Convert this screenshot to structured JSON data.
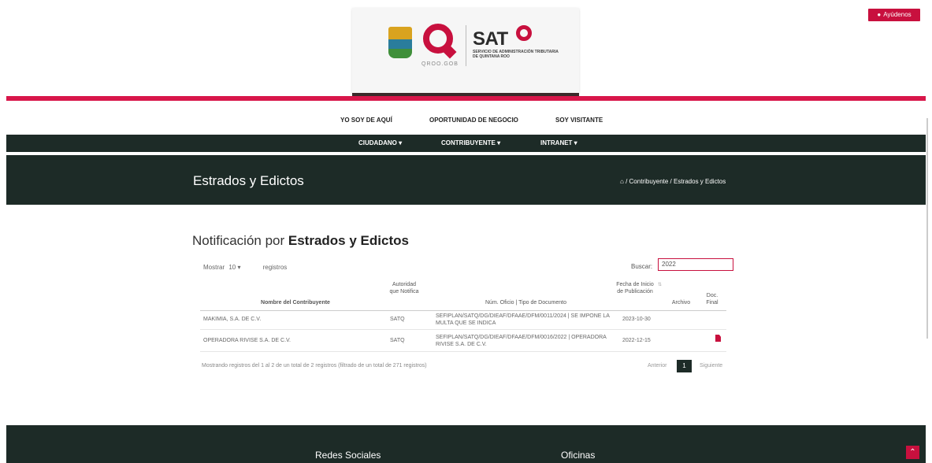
{
  "header": {
    "logo_sub": "QROO.GOB",
    "sat_brand": "SAT",
    "sat_subtitle": "SERVICIO DE ADMINISTRACIÓN TRIBUTARIA DE QUINTANA ROO",
    "ayuda_label": "Ayúdenos"
  },
  "subnav": [
    "YO SOY DE AQUÍ",
    "OPORTUNIDAD DE NEGOCIO",
    "SOY VISITANTE"
  ],
  "mainnav": [
    "CIUDADANO ▾",
    "CONTRIBUYENTE ▾",
    "INTRANET ▾"
  ],
  "banner": {
    "title": "Estrados y Edictos",
    "breadcrumb_home": "⌂",
    "breadcrumb": "/ Contribuyente / Estrados y Edictos"
  },
  "content": {
    "heading_prefix": "Notificación por ",
    "heading_bold": "Estrados y Edictos",
    "mostrar_label": "Mostrar",
    "mostrar_value": "10",
    "mostrar_suffix": "registros",
    "buscar_label": "Buscar:",
    "buscar_value": "2022",
    "table": {
      "headers": [
        "Nombre del Contribuyente",
        "Autoridad que Notifica",
        "Núm. Oficio | Tipo de Documento",
        "Fecha de Inicio de Publicación",
        "Archivo",
        "Doc. Final"
      ],
      "rows": [
        {
          "nombre": "MAKIMIA, S.A. DE C.V.",
          "autoridad": "SATQ",
          "oficio": "SEFIPLAN/SATQ/DG/DIEAF/DFAAE/DFM/0011/2024 | SE IMPONE LA MULTA QUE SE INDICA",
          "fecha": "2023-10-30"
        },
        {
          "nombre": "OPERADORA RIVISE S.A. DE C.V.",
          "autoridad": "SATQ",
          "oficio": "SEFIPLAN/SATQ/DG/DIEAF/DFAAE/DFM/0016/2022 | OPERADORA RIVISE S.A. DE C.V.",
          "fecha": "2022-12-15"
        }
      ]
    },
    "info": "Mostrando registros del 1 al 2 de un total de 2 registros (filtrado de un total de 271 registros)",
    "pag_prev": "Anterior",
    "pag_current": "1",
    "pag_next": "Siguiente"
  },
  "footer": {
    "redes": "Redes Sociales",
    "oficinas": "Oficinas",
    "scroll_top": "⌃"
  },
  "colors": {
    "brand_red": "#c8103e",
    "dark_green": "#1d2b27",
    "pink_line": "#d8164a"
  }
}
